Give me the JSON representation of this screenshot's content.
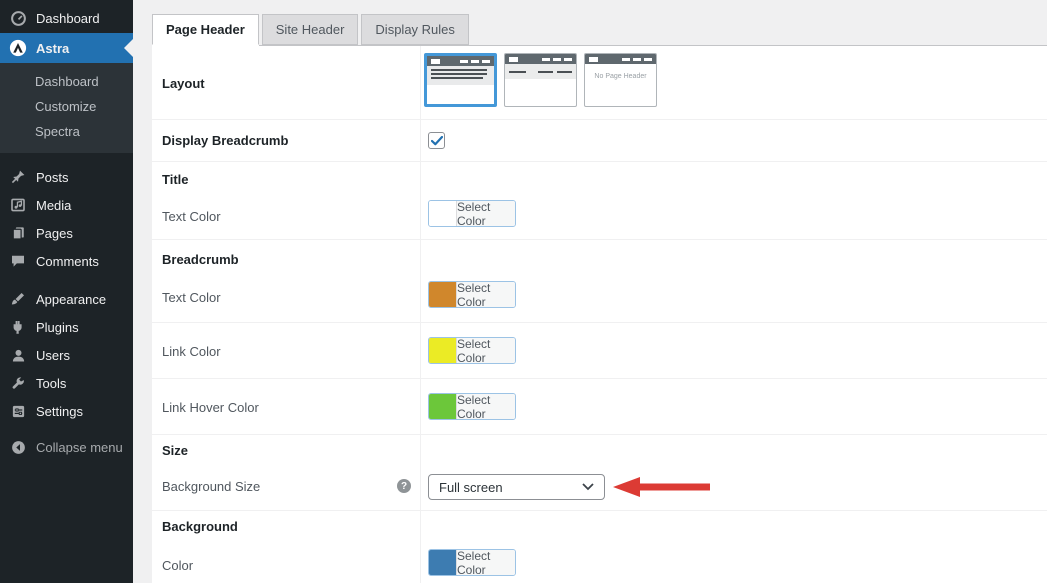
{
  "sidebar": {
    "items": [
      {
        "label": "Dashboard",
        "icon": "dashboard-icon"
      },
      {
        "label": "Astra",
        "icon": "astra-logo-icon",
        "active": true
      },
      {
        "label": "Posts",
        "icon": "pushpin-icon"
      },
      {
        "label": "Media",
        "icon": "media-icon"
      },
      {
        "label": "Pages",
        "icon": "pages-icon"
      },
      {
        "label": "Comments",
        "icon": "comment-icon"
      },
      {
        "label": "Appearance",
        "icon": "appearance-brush-icon"
      },
      {
        "label": "Plugins",
        "icon": "plugin-icon"
      },
      {
        "label": "Users",
        "icon": "user-icon"
      },
      {
        "label": "Tools",
        "icon": "wrench-icon"
      },
      {
        "label": "Settings",
        "icon": "settings-icon"
      }
    ],
    "astra_submenu": [
      {
        "label": "Dashboard"
      },
      {
        "label": "Customize"
      },
      {
        "label": "Spectra"
      }
    ],
    "collapse_label": "Collapse menu"
  },
  "tabs": [
    {
      "label": "Page Header",
      "active": true
    },
    {
      "label": "Site Header",
      "active": false
    },
    {
      "label": "Display Rules",
      "active": false
    }
  ],
  "panel": {
    "layout_label": "Layout",
    "layout_selected_index": 0,
    "no_page_header_text": "No Page Header",
    "display_breadcrumb_label": "Display Breadcrumb",
    "display_breadcrumb_checked": true,
    "title_heading": "Title",
    "title_text_color_label": "Text Color",
    "breadcrumb_heading": "Breadcrumb",
    "breadcrumb_text_color_label": "Text Color",
    "link_color_label": "Link Color",
    "link_hover_color_label": "Link Hover Color",
    "size_heading": "Size",
    "background_size_label": "Background Size",
    "background_size_value": "Full screen",
    "help_glyph": "?",
    "background_heading": "Background",
    "background_color_label": "Color",
    "select_color_label": "Select Color",
    "swatches": {
      "title_text": "#ffffff",
      "breadcrumb_text": "#d0872c",
      "link": "#ebeb25",
      "link_hover": "#6cc73a",
      "background": "#3d7cb1"
    }
  },
  "colors": {
    "sidebar_bg": "#1d2327",
    "active_item_blue": "#2271b1",
    "selected_thumb_border": "#4498d8",
    "annotation_arrow_red": "#dc3b34"
  }
}
